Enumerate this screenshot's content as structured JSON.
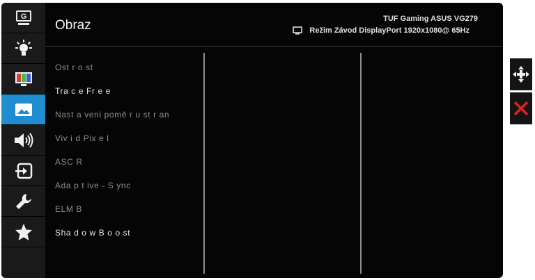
{
  "header": {
    "title": "Obraz",
    "model": "TUF Gaming ASUS VG279",
    "status": "Režim Závod DisplayPort 1920x1080@ 65Hz"
  },
  "sidebar": {
    "items": [
      {
        "icon": "gameplus-icon",
        "label": "G"
      },
      {
        "icon": "brightness-icon"
      },
      {
        "icon": "color-icon"
      },
      {
        "icon": "image-icon",
        "active": true
      },
      {
        "icon": "sound-icon"
      },
      {
        "icon": "input-select-icon"
      },
      {
        "icon": "wrench-icon"
      },
      {
        "icon": "star-icon"
      }
    ]
  },
  "menu": {
    "items": [
      {
        "label": "Ost r o st",
        "bright": false
      },
      {
        "label": "Tra c e  Fr e e",
        "bright": true
      },
      {
        "label": "Nast a veni   pomě r u st r an",
        "bright": false
      },
      {
        "label": "Viv i d Pix e l",
        "bright": false
      },
      {
        "label": "ASC R",
        "bright": false
      },
      {
        "label": "Ada p t ive - S ync",
        "bright": false
      },
      {
        "label": "ELM B",
        "bright": false
      },
      {
        "label": "Sha d o w B o o st",
        "bright": true
      }
    ]
  },
  "colors": {
    "accent": "#1e8ecf",
    "close": "#e02020",
    "background": "#050505"
  }
}
